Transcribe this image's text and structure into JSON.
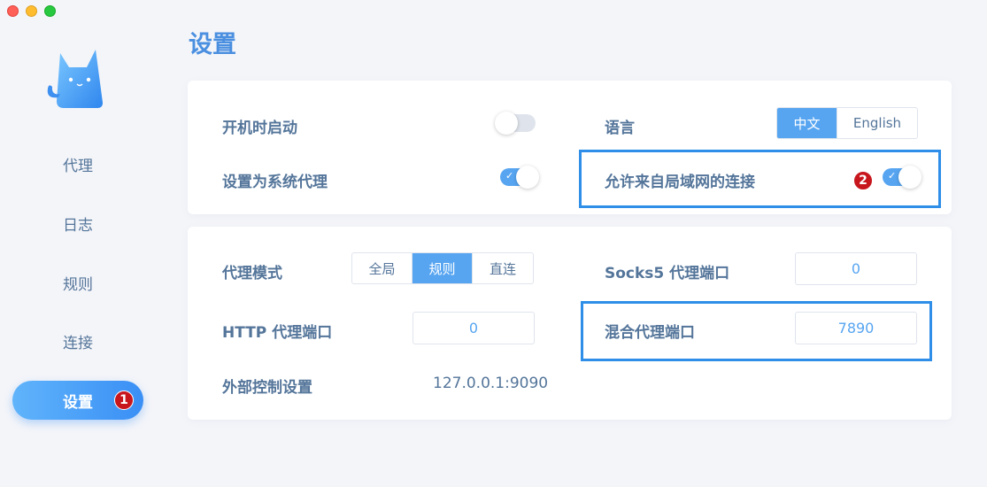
{
  "sidebar": {
    "items": [
      {
        "label": "代理"
      },
      {
        "label": "日志"
      },
      {
        "label": "规则"
      },
      {
        "label": "连接"
      },
      {
        "label": "设置",
        "active": true,
        "badge": "1"
      }
    ]
  },
  "page": {
    "title": "设置"
  },
  "general": {
    "launch_at_startup": {
      "label": "开机时启动",
      "enabled": false
    },
    "set_system_proxy": {
      "label": "设置为系统代理",
      "enabled": true
    },
    "language": {
      "label": "语言",
      "options": [
        "中文",
        "English"
      ],
      "selected": "中文"
    },
    "allow_lan": {
      "label": "允许来自局域网的连接",
      "enabled": true,
      "badge": "2"
    }
  },
  "proxy": {
    "mode": {
      "label": "代理模式",
      "options": [
        "全局",
        "规则",
        "直连"
      ],
      "selected": "规则"
    },
    "http_port": {
      "label": "HTTP 代理端口",
      "value": "0"
    },
    "external_controller": {
      "label": "外部控制设置",
      "value": "127.0.0.1:9090"
    },
    "socks5_port": {
      "label": "Socks5 代理端口",
      "value": "0"
    },
    "mixed_port": {
      "label": "混合代理端口",
      "value": "7890"
    }
  },
  "colors": {
    "accent": "#57a5f1",
    "text": "#54759a",
    "highlight": "#2f8fe8",
    "badge": "#c8161d"
  }
}
